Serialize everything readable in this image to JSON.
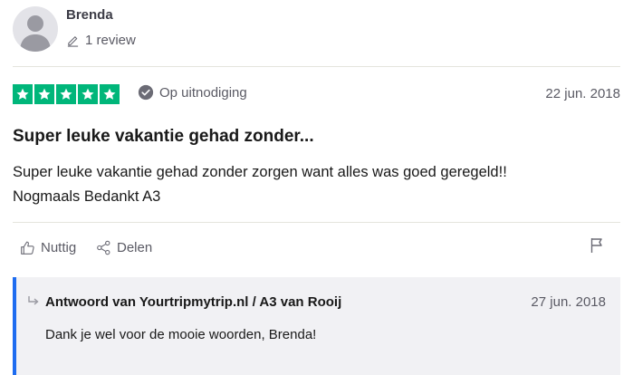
{
  "reviewer": {
    "name": "Brenda",
    "review_count": "1 review",
    "avatar_icon": "person-silhouette-icon",
    "pencil_icon": "pencil-icon"
  },
  "rating": {
    "stars": 5,
    "star_color": "#00b67a",
    "verification_label": "Op uitnodiging",
    "verification_icon": "check-circle-icon",
    "date": "22 jun. 2018"
  },
  "review": {
    "title": "Super leuke vakantie gehad zonder...",
    "body_line_1": "Super leuke vakantie gehad zonder zorgen want alles was goed geregeld!!",
    "body_line_2": "Nogmaals Bedankt A3"
  },
  "actions": {
    "useful_label": "Nuttig",
    "useful_icon": "thumbs-up-icon",
    "share_label": "Delen",
    "share_icon": "share-icon",
    "flag_icon": "flag-icon"
  },
  "reply": {
    "accent_color": "#1e6cf0",
    "arrow_icon": "reply-arrow-icon",
    "title": "Antwoord van Yourtripmytrip.nl / A3 van Rooij",
    "date": "27 jun. 2018",
    "text": "Dank je wel voor de mooie woorden, Brenda!"
  }
}
